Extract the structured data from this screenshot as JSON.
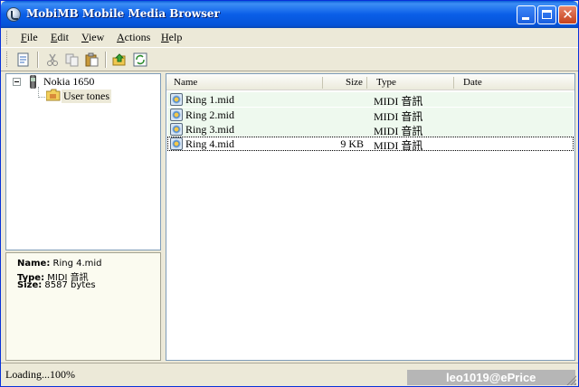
{
  "window": {
    "title": "MobiMB Mobile Media Browser",
    "titlebar_color": "#0a5fd8"
  },
  "menu": {
    "items": [
      {
        "label": "File",
        "accel": "F",
        "rest": "ile"
      },
      {
        "label": "Edit",
        "accel": "E",
        "rest": "dit"
      },
      {
        "label": "View",
        "accel": "V",
        "rest": "iew"
      },
      {
        "label": "Actions",
        "accel": "A",
        "rest": "ctions"
      },
      {
        "label": "Help",
        "accel": "H",
        "rest": "elp"
      }
    ]
  },
  "toolbar": {
    "buttons": [
      "properties-icon",
      "cut-icon",
      "copy-icon",
      "paste-icon",
      "upload-icon",
      "refresh-icon"
    ]
  },
  "tree": {
    "root": {
      "label": "Nokia 1650",
      "icon": "phone-icon",
      "expanded": true
    },
    "children": [
      {
        "label": "User tones",
        "icon": "folder-icon",
        "selected": true
      }
    ]
  },
  "info": {
    "name_label": "Name:",
    "name_value": "Ring 4.mid",
    "type_label": "Type:",
    "type_value": "MIDI 音訊",
    "size_label": "Size:",
    "size_value": "8587 bytes"
  },
  "list": {
    "columns": [
      "Name",
      "Size",
      "Type",
      "Date"
    ],
    "rows": [
      {
        "name": "Ring 1.mid",
        "size": "",
        "type": "MIDI 音訊",
        "date": ""
      },
      {
        "name": "Ring 2.mid",
        "size": "",
        "type": "MIDI 音訊",
        "date": ""
      },
      {
        "name": "Ring 3.mid",
        "size": "",
        "type": "MIDI 音訊",
        "date": ""
      },
      {
        "name": "Ring 4.mid",
        "size": "9 KB",
        "type": "MIDI 音訊",
        "date": "",
        "focused": true
      }
    ]
  },
  "status": {
    "text": "Loading...100%",
    "watermark": "leo1019@ePrice"
  }
}
